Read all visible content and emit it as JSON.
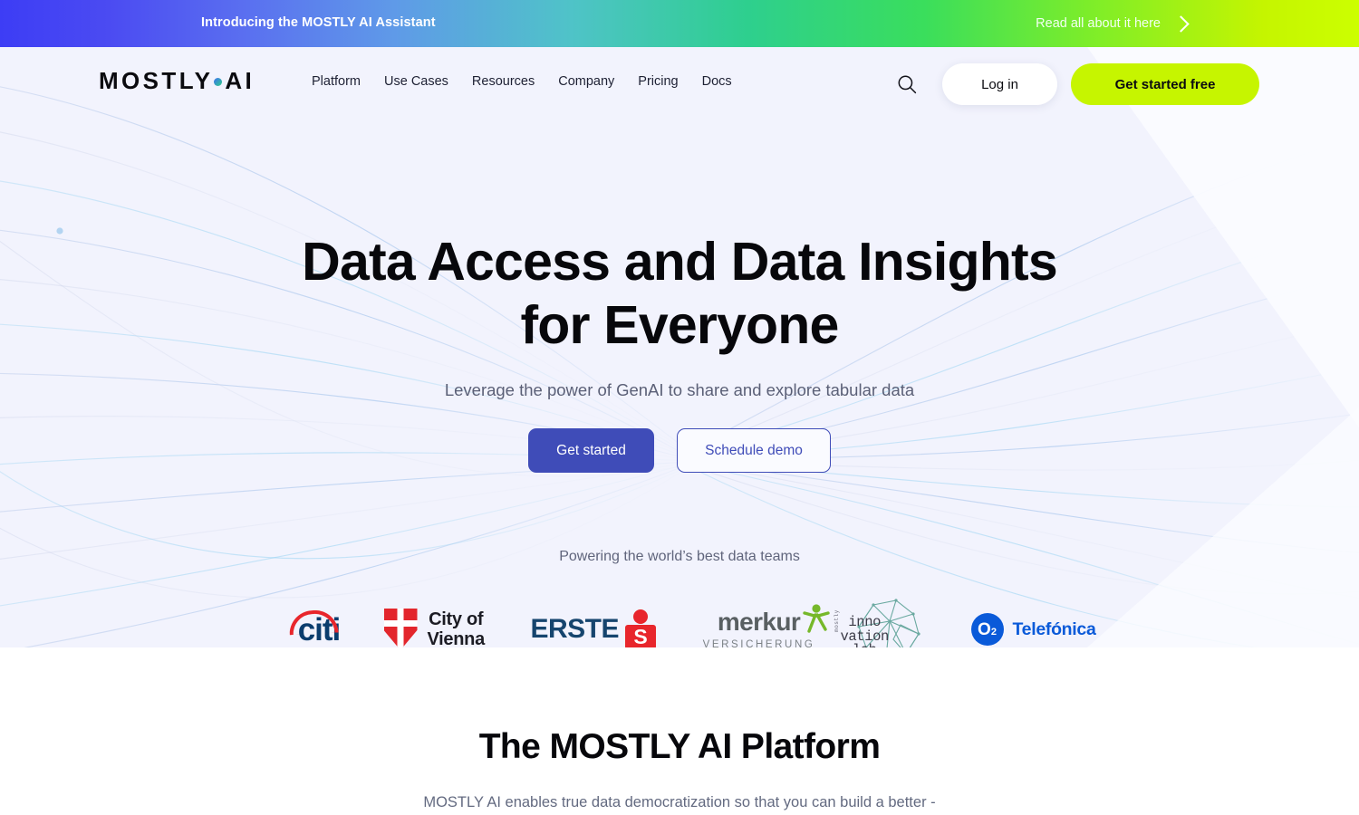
{
  "announcement": {
    "title": "Introducing the MOSTLY AI Assistant",
    "cta_label": "Read all about it here",
    "chevron_icon": "chevron-right-icon",
    "gradient_start": "#3d3df5",
    "gradient_mid": "#2ecf8e",
    "gradient_end": "#ccff00"
  },
  "nav": {
    "brand_left": "MOSTLY",
    "brand_dot_icon": "gradient-dot-icon",
    "brand_right": "AI",
    "links": [
      {
        "label": "Platform"
      },
      {
        "label": "Use Cases"
      },
      {
        "label": "Resources"
      },
      {
        "label": "Company"
      },
      {
        "label": "Pricing"
      },
      {
        "label": "Docs"
      }
    ],
    "search_icon": "search-icon",
    "login_label": "Log in",
    "signup_label": "Get started free",
    "signup_color": "#c6f500"
  },
  "hero": {
    "title_line1": "Data Access and Data Insights",
    "title_line2": "for Everyone",
    "subtitle": "Leverage the power of GenAI to share and explore tabular data",
    "primary_cta": "Get started",
    "secondary_cta": "Schedule demo",
    "primary_color": "#3f4cb8",
    "background_color": "#f2f3fd"
  },
  "social_proof": {
    "label": "Powering the world’s best data teams",
    "logos": [
      {
        "name": "citi",
        "text": "citi",
        "color": "#0a3d6e",
        "accent": "#e8262c"
      },
      {
        "name": "city-of-vienna",
        "line1": "City of",
        "line2": "Vienna",
        "color": "#1c1c24",
        "accent": "#e3262c"
      },
      {
        "name": "erste",
        "text": "ERSTE",
        "mark": "S",
        "color": "#16456e",
        "accent": "#e8262c"
      },
      {
        "name": "merkur",
        "text": "merkur",
        "sub": "VERSICHERUNG",
        "color": "#595f62",
        "accent": "#76b82a"
      },
      {
        "name": "innovation-lab",
        "line1": "inno",
        "line2": "vation",
        "line3": "lab",
        "vertical": "mostly",
        "color": "#3c3c48",
        "accent": "#6aa9a0"
      },
      {
        "name": "o2-telefonica",
        "mark": "O",
        "mark_sub": "2",
        "text": "Telefónica",
        "color": "#0a5ad9"
      }
    ]
  },
  "platform_section": {
    "title": "The MOSTLY AI Platform",
    "subtitle": "MOSTLY AI enables true data democratization so that you can build a better -"
  }
}
